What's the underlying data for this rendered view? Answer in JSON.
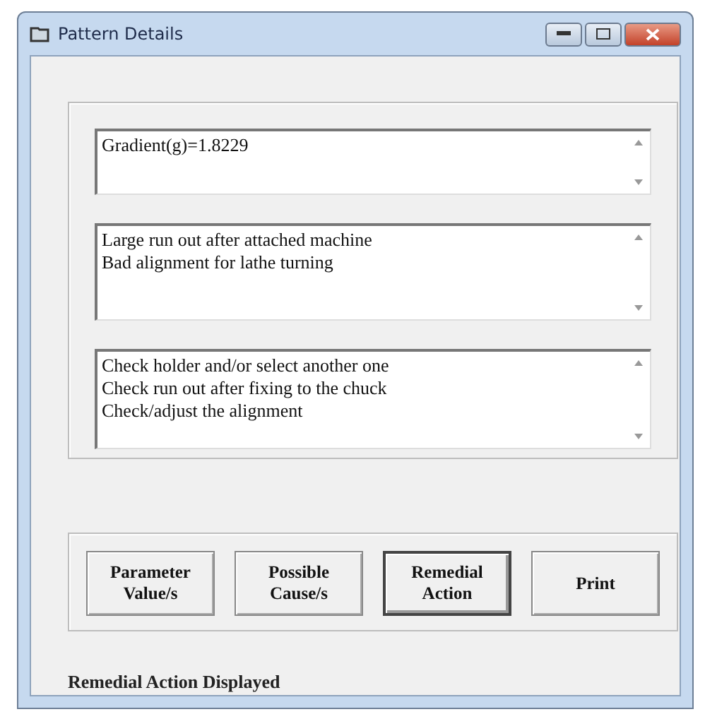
{
  "window": {
    "title": "Pattern Details"
  },
  "text_boxes": [
    {
      "lines": [
        "Gradient(g)=1.8229"
      ]
    },
    {
      "lines": [
        "Large run out after attached machine",
        "Bad alignment for lathe turning"
      ]
    },
    {
      "lines": [
        "Check holder and/or select another one",
        "Check run out after fixing to the chuck",
        "Check/adjust the alignment"
      ]
    }
  ],
  "buttons": [
    {
      "lines": [
        "Parameter",
        "Value/s"
      ],
      "selected": false
    },
    {
      "lines": [
        "Possible",
        "Cause/s"
      ],
      "selected": false
    },
    {
      "lines": [
        "Remedial",
        "Action"
      ],
      "selected": true
    },
    {
      "lines": [
        "Print"
      ],
      "selected": false
    }
  ],
  "status": "Remedial Action Displayed"
}
